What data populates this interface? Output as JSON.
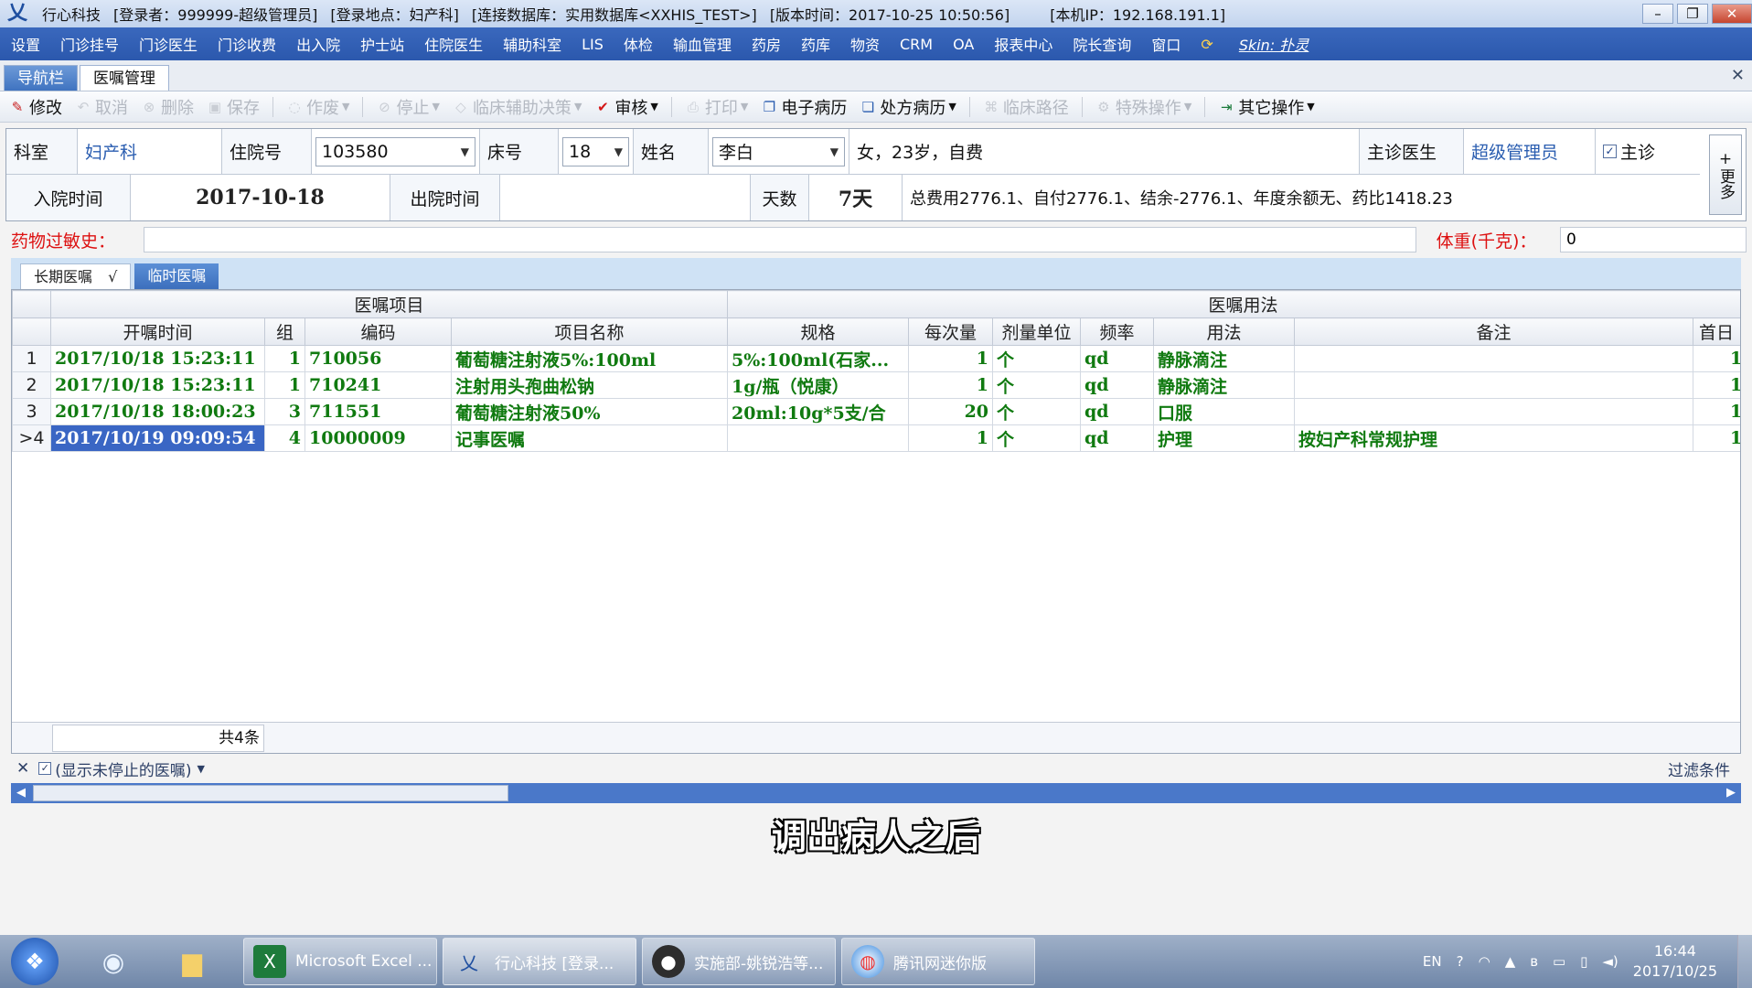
{
  "titlebar": {
    "app_name": "行心科技",
    "login_user": "[登录者：999999-超级管理员]",
    "login_place": "[登录地点：妇产科]",
    "database": "[连接数据库：实用数据库<XXHIS_TEST>]",
    "version": "[版本时间：2017-10-25 10:50:56]",
    "ip": "[本机IP：192.168.191.1]"
  },
  "menu": {
    "items": [
      "设置",
      "门诊挂号",
      "门诊医生",
      "门诊收费",
      "出入院",
      "护士站",
      "住院医生",
      "辅助科室",
      "LIS",
      "体检",
      "输血管理",
      "药房",
      "药库",
      "物资",
      "CRM",
      "OA",
      "报表中心",
      "院长查询",
      "窗口"
    ],
    "skin_label": "Skin: 扑灵"
  },
  "tabs": {
    "nav": "导航栏",
    "active": "医嘱管理"
  },
  "toolbar": {
    "modify": "修改",
    "cancel": "取消",
    "delete": "删除",
    "save": "保存",
    "void": "作废",
    "stop": "停止",
    "clinical_decision": "临床辅助决策",
    "review": "审核",
    "print": "打印",
    "emr": "电子病历",
    "rx_record": "处方病历",
    "clinical_path": "临床路径",
    "special_ops": "特殊操作",
    "other_ops": "其它操作"
  },
  "patient": {
    "dept_label": "科室",
    "dept_value": "妇产科",
    "inpatient_no_label": "住院号",
    "inpatient_no": "103580",
    "bed_label": "床号",
    "bed": "18",
    "name_label": "姓名",
    "name": "李白",
    "summary": "女，23岁，自费",
    "doctor_label": "主诊医生",
    "doctor": "超级管理员",
    "primary_label": "主诊",
    "admit_label": "入院时间",
    "admit_date": "2017-10-18",
    "discharge_label": "出院时间",
    "discharge_date": "",
    "days_label": "天数",
    "days": "7天",
    "fee_summary": "总费用2776.1、自付2776.1、结余-2776.1、年度余额无、药比1418.23",
    "more_label": "更多"
  },
  "allergy": {
    "label": "药物过敏史：",
    "value": "",
    "weight_label": "体重(千克)：",
    "weight": "0"
  },
  "order_tabs": {
    "long_term": "长期医嘱",
    "long_term_mark": "√",
    "temporary": "临时医嘱"
  },
  "grid": {
    "group_items": "医嘱项目",
    "group_usage": "医嘱用法",
    "columns": [
      "开嘱时间",
      "组",
      "编码",
      "项目名称",
      "规格",
      "每次量",
      "剂量单位",
      "频率",
      "用法",
      "备注",
      "首日"
    ],
    "rows": [
      {
        "rn": "1",
        "time": "2017/10/18 15:23:11",
        "group": "1",
        "code": "710056",
        "name": "葡萄糖注射液5%:100ml",
        "spec": "5%:100ml(石家...",
        "qty": "1",
        "unit": "个",
        "freq": "qd",
        "usage": "静脉滴注",
        "note": "",
        "first": "1"
      },
      {
        "rn": "2",
        "time": "2017/10/18 15:23:11",
        "group": "1",
        "code": "710241",
        "name": "注射用头孢曲松钠",
        "spec": "1g/瓶（悦康）",
        "qty": "1",
        "unit": "个",
        "freq": "qd",
        "usage": "静脉滴注",
        "note": "",
        "first": "1"
      },
      {
        "rn": "3",
        "time": "2017/10/18 18:00:23",
        "group": "3",
        "code": "711551",
        "name": "葡萄糖注射液50%",
        "spec": "20ml:10g*5支/合",
        "qty": "20",
        "unit": "个",
        "freq": "qd",
        "usage": "口服",
        "note": "",
        "first": "1"
      },
      {
        "rn": ">4",
        "time": "2017/10/19 09:09:54",
        "group": "4",
        "code": "10000009",
        "name": "记事医嘱",
        "spec": "",
        "qty": "1",
        "unit": "个",
        "freq": "qd",
        "usage": "护理",
        "note": "按妇产科常规护理",
        "first": "1"
      }
    ],
    "count": "共4条"
  },
  "filter": {
    "show_active": "(显示未停止的医嘱)",
    "filter_label": "过滤条件"
  },
  "subtitle": "调出病人之后",
  "taskbar": {
    "tasks": [
      "Microsoft Excel ...",
      "行心科技 [登录...",
      "实施部-姚锐浩等...",
      "腾讯网迷你版"
    ],
    "lang": "EN",
    "time": "16:44",
    "date": "2017/10/25"
  }
}
